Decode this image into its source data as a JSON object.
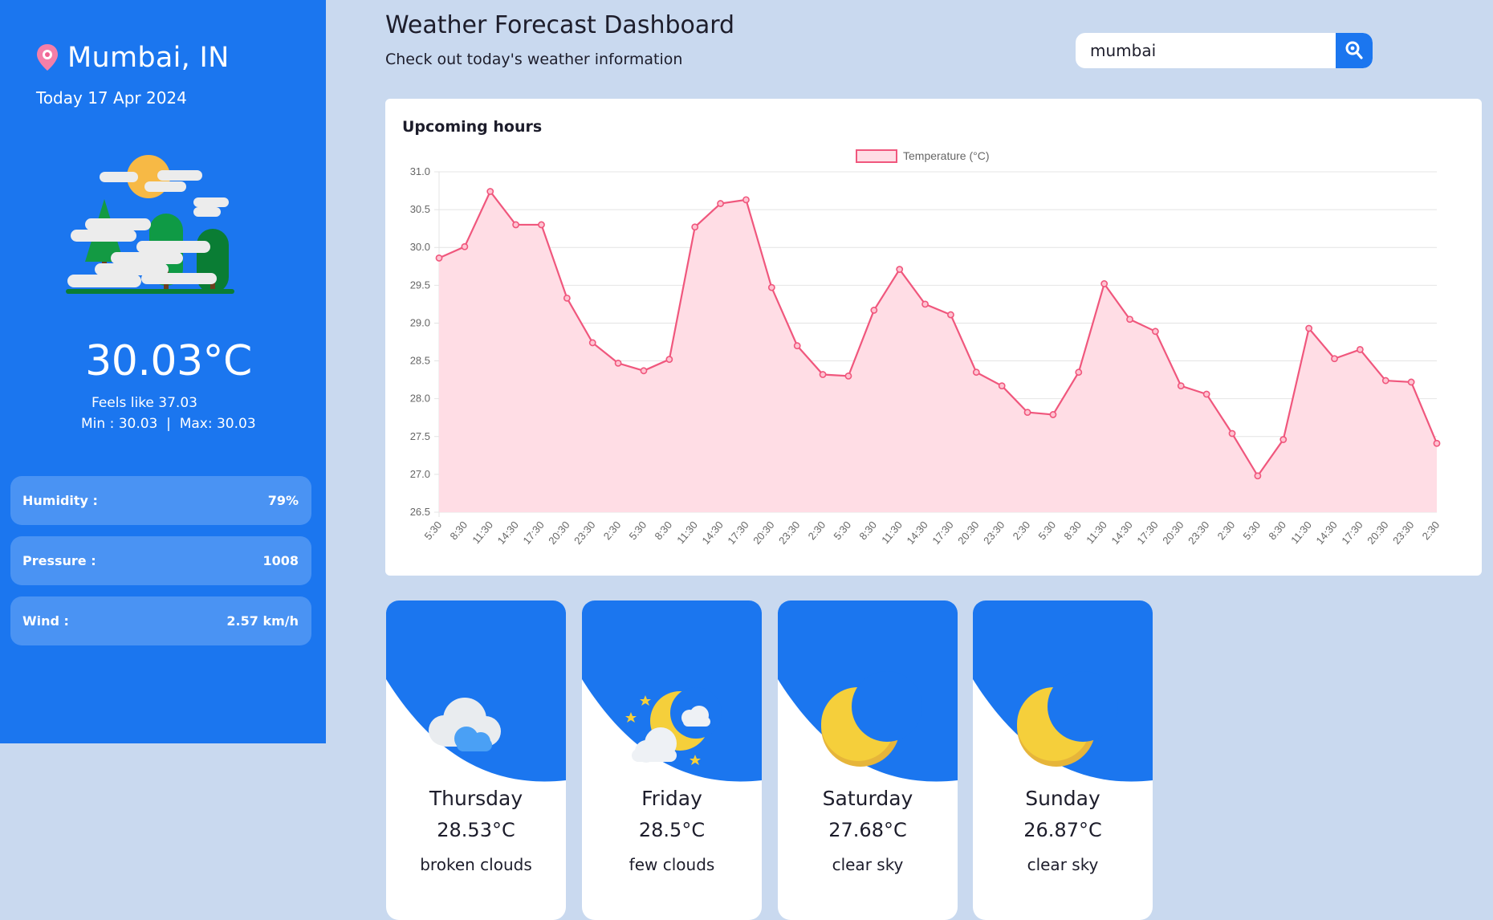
{
  "sidebar": {
    "city": "Mumbai, IN",
    "date": "Today 17 Apr 2024",
    "temperature": "30.03°C",
    "feels_like": "Feels like 37.03",
    "min_max": "Min : 30.03  |  Max: 30.03",
    "stats": [
      {
        "label": "Humidity :",
        "value": "79%"
      },
      {
        "label": "Pressure :",
        "value": "1008"
      },
      {
        "label": "Wind :",
        "value": "2.57 km/h"
      }
    ]
  },
  "header": {
    "title": "Weather Forecast Dashboard",
    "subtitle": "Check out today's weather information"
  },
  "search": {
    "value": "mumbai",
    "placeholder": ""
  },
  "chart_title": "Upcoming hours",
  "chart_data": {
    "type": "line",
    "legend": "Temperature (°C)",
    "legend_position": "top-center",
    "fill": true,
    "grid": true,
    "ylim": [
      26.5,
      31.0
    ],
    "y_ticks": [
      "31.0",
      "30.5",
      "30.0",
      "29.5",
      "29.0",
      "28.5",
      "28.0",
      "27.5",
      "27.0",
      "26.5"
    ],
    "x": [
      "5:30",
      "8:30",
      "11:30",
      "14:30",
      "17:30",
      "20:30",
      "23:30",
      "2:30",
      "5:30",
      "8:30",
      "11:30",
      "14:30",
      "17:30",
      "20:30",
      "23:30",
      "2:30",
      "5:30",
      "8:30",
      "11:30",
      "14:30",
      "17:30",
      "20:30",
      "23:30",
      "2:30",
      "5:30",
      "8:30",
      "11:30",
      "14:30",
      "17:30",
      "20:30",
      "23:30",
      "2:30",
      "5:30",
      "8:30",
      "11:30",
      "14:30",
      "17:30",
      "20:30",
      "23:30",
      "2:30"
    ],
    "series": [
      {
        "name": "Temperature (°C)",
        "values": [
          29.86,
          30.01,
          30.74,
          30.3,
          30.3,
          29.33,
          28.74,
          28.47,
          28.37,
          28.52,
          30.27,
          30.58,
          30.63,
          29.47,
          28.7,
          28.32,
          28.3,
          29.17,
          29.71,
          29.25,
          29.11,
          28.35,
          28.17,
          27.82,
          27.79,
          28.35,
          29.52,
          29.05,
          28.89,
          28.17,
          28.06,
          27.54,
          26.98,
          27.46,
          28.93,
          28.53,
          28.65,
          28.24,
          28.22,
          27.41
        ],
        "color": "#f0577d"
      }
    ]
  },
  "forecast": [
    {
      "day": "Thursday",
      "temp": "28.53°C",
      "desc": "broken clouds",
      "icon": "cloud-icon"
    },
    {
      "day": "Friday",
      "temp": "28.5°C",
      "desc": "few clouds",
      "icon": "moon-cloud-icon"
    },
    {
      "day": "Saturday",
      "temp": "27.68°C",
      "desc": "clear sky",
      "icon": "moon-icon"
    },
    {
      "day": "Sunday",
      "temp": "26.87°C",
      "desc": "clear sky",
      "icon": "moon-icon"
    }
  ],
  "colors": {
    "accent": "#1b76ef",
    "background": "#c9d9ef",
    "stat_pill": "#4a93f3",
    "line": "#f0577d",
    "fill": "#ffdde5"
  }
}
